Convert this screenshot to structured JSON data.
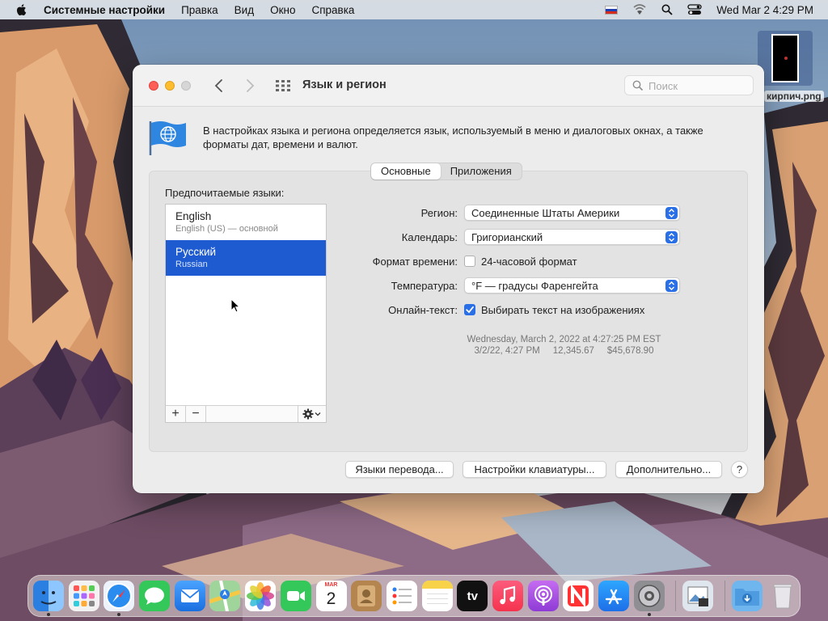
{
  "menubar": {
    "app_name": "Системные настройки",
    "items": [
      "Правка",
      "Вид",
      "Окно",
      "Справка"
    ],
    "clock": "Wed Mar 2  4:29 PM"
  },
  "desktop_file": {
    "name": "кирпич.png"
  },
  "window": {
    "title": "Язык и регион",
    "search_placeholder": "Поиск",
    "intro": "В настройках языка и региона определяется язык, используемый в меню и диалоговых окнах, а также форматы дат, времени и валют.",
    "tabs": [
      {
        "label": "Основные",
        "active": true
      },
      {
        "label": "Приложения",
        "active": false
      }
    ],
    "preferred_languages_label": "Предпочитаемые языки:",
    "languages": [
      {
        "name": "English",
        "sub": "English (US) — основной",
        "selected": false
      },
      {
        "name": "Русский",
        "sub": "Russian",
        "selected": true
      }
    ],
    "list_tools": {
      "add": "+",
      "remove": "−"
    },
    "form": {
      "region": {
        "label": "Регион:",
        "value": "Соединенные Штаты Америки"
      },
      "calendar": {
        "label": "Календарь:",
        "value": "Григорианский"
      },
      "time_format": {
        "label": "Формат времени:",
        "checkbox": "24-часовой формат",
        "checked": false
      },
      "temperature": {
        "label": "Температура:",
        "value": "°F — градусы Фаренгейта"
      },
      "live_text": {
        "label": "Онлайн-текст:",
        "checkbox": "Выбирать текст на изображениях",
        "checked": true
      }
    },
    "sample": {
      "long_date": "Wednesday, March 2, 2022 at 4:27:25 PM EST",
      "short_date": "3/2/22, 4:27 PM",
      "number": "12,345.67",
      "currency": "$45,678.90"
    },
    "buttons": {
      "translation_languages": "Языки перевода...",
      "keyboard_settings": "Настройки клавиатуры...",
      "advanced": "Дополнительно...",
      "help": "?"
    }
  },
  "dock": {
    "calendar_month": "MAR",
    "calendar_day": "2",
    "tv_label": "tv"
  },
  "colors": {
    "accent": "#2a6fe6",
    "selection": "#1e5bd0"
  }
}
